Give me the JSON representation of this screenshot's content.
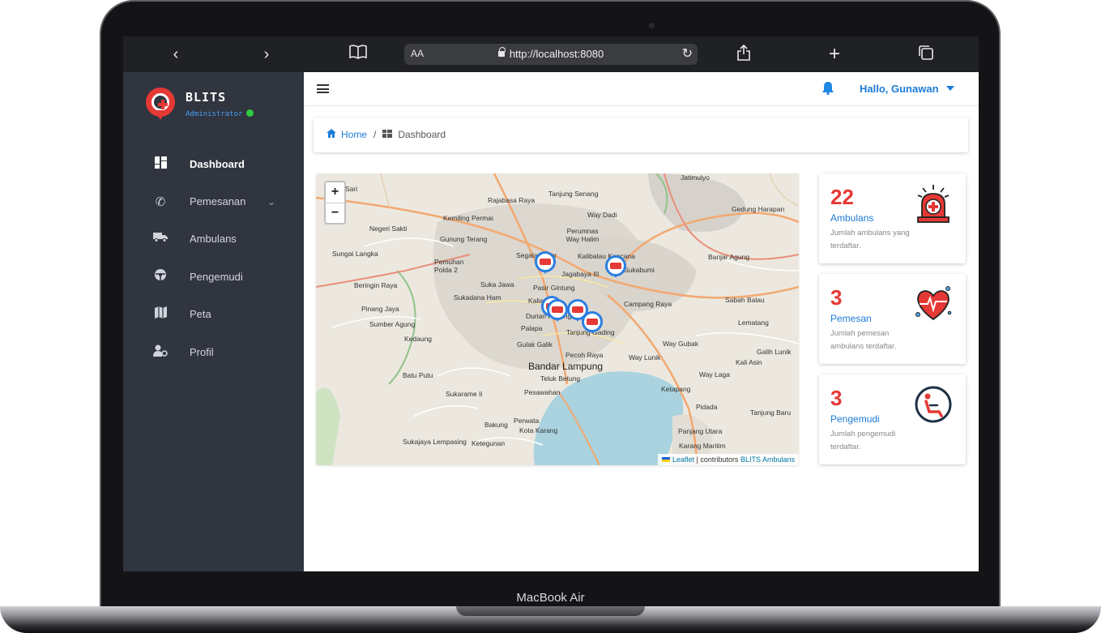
{
  "device": {
    "label": "MacBook Air"
  },
  "browser": {
    "aa_label": "AA",
    "url": "http://localhost:8080",
    "icons": [
      "chevron-left-icon",
      "chevron-right-icon",
      "book-icon",
      "reload-icon",
      "share-icon",
      "plus-icon",
      "tabs-icon"
    ]
  },
  "sidebar": {
    "app_name": "BLITS",
    "role": "Administrator",
    "items": [
      {
        "label": "Dashboard",
        "icon": "dashboard-icon",
        "active": true
      },
      {
        "label": "Pemesanan",
        "icon": "phone-call-icon",
        "has_submenu": true
      },
      {
        "label": "Ambulans",
        "icon": "truck-icon"
      },
      {
        "label": "Pengemudi",
        "icon": "steering-wheel-icon"
      },
      {
        "label": "Peta",
        "icon": "map-icon"
      },
      {
        "label": "Profil",
        "icon": "user-cog-icon"
      }
    ]
  },
  "topbar": {
    "user_greeting": "Hallo, Gunawan"
  },
  "breadcrumb": {
    "home": "Home",
    "separator": "/",
    "current": "Dashboard"
  },
  "map": {
    "zoom_in": "+",
    "zoom_out": "−",
    "labels": [
      "Rajabasa Raya",
      "Tanjung Senang",
      "Kemiling Permai",
      "Way Dadi",
      "Gedung Harapan",
      "Negeri Sakti",
      "Perumnas Way Halim",
      "Gunung Terang",
      "Sungai Langka",
      "Segala Mider",
      "Kalibalau Kencana",
      "Banjar Agung",
      "Pemuhan Polda 2",
      "Jagabaya III",
      "Sukabumi",
      "Beringin Raya",
      "Suka Jawa",
      "Pasir Gintung",
      "Sukadana Ham",
      "Kaliawi",
      "Campang Raya",
      "Sabah Balau",
      "Pinang Jaya",
      "Durian Payung",
      "Sumber Agung",
      "Palapa",
      "Tanjung Gading",
      "Lematang",
      "Kedaung",
      "Gulak Galik",
      "Way Gubak",
      "Pecoh Raya",
      "Way Lunik",
      "Galih Lunik",
      "Bandar Lampung",
      "Kali Asin",
      "Batu Putu",
      "Teluk Betung",
      "Way Laga",
      "Sukarame Ii",
      "Pesawahan",
      "Ketapang",
      "Pidada",
      "Tanjung Baru",
      "Perwata",
      "Bakung",
      "Kota Karang",
      "Panjang Utara",
      "Sukajaya Lempasing",
      "Ketegunan",
      "Karang Maritim",
      "Jatimulyo",
      "Sari"
    ],
    "attribution_leaflet": "Leaflet",
    "attribution_mid": "| contributors",
    "attribution_brand": "BLITS Ambulans"
  },
  "stats": [
    {
      "value": "22",
      "title": "Ambulans",
      "desc": "Jumlah ambulans yang terdaftar.",
      "icon": "ambulance-siren-icon"
    },
    {
      "value": "3",
      "title": "Pemesan",
      "desc": "Jumlah pemesan ambulans terdaftar.",
      "icon": "heart-pulse-icon"
    },
    {
      "value": "3",
      "title": "Pengemudi",
      "desc": "Jumlah pengemudi terdaftar.",
      "icon": "driver-seat-icon"
    }
  ],
  "colors": {
    "accent_red": "#e53935",
    "accent_blue": "#1e7bd8",
    "sidebar_bg": "#30353f"
  }
}
